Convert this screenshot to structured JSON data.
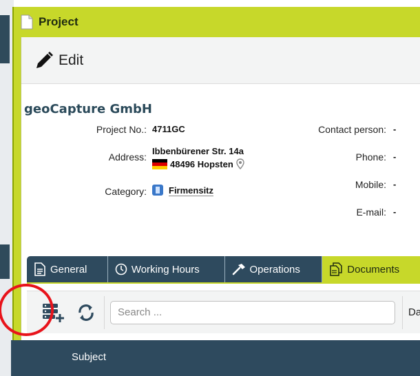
{
  "window": {
    "title": "Project"
  },
  "edit": {
    "label": "Edit"
  },
  "company": "geoCapture GmbH",
  "details": {
    "project_no_label": "Project No.:",
    "project_no": "4711GC",
    "address_label": "Address:",
    "street": "Ibbenbürener Str. 14a",
    "city": "48496 Hopsten",
    "category_label": "Category:",
    "category": "Firmensitz",
    "contact_label": "Contact person:",
    "contact": "-",
    "phone_label": "Phone:",
    "phone": "-",
    "mobile_label": "Mobile:",
    "mobile": "-",
    "email_label": "E-mail:",
    "email": "-"
  },
  "tabs": [
    {
      "label": "General",
      "icon": "document-icon"
    },
    {
      "label": "Working Hours",
      "icon": "clock-icon"
    },
    {
      "label": "Operations",
      "icon": "hammer-icon"
    },
    {
      "label": "Documents",
      "icon": "documents-icon",
      "active": true
    }
  ],
  "toolbar": {
    "add_icon": "add-document-icon",
    "refresh_icon": "refresh-icon",
    "search_placeholder": "Search ...",
    "date_label": "Dat"
  },
  "table": {
    "columns": [
      "Subject"
    ]
  },
  "colors": {
    "accent": "#c7d82a",
    "header": "#2e4a5e",
    "highlight": "#e8131b"
  }
}
